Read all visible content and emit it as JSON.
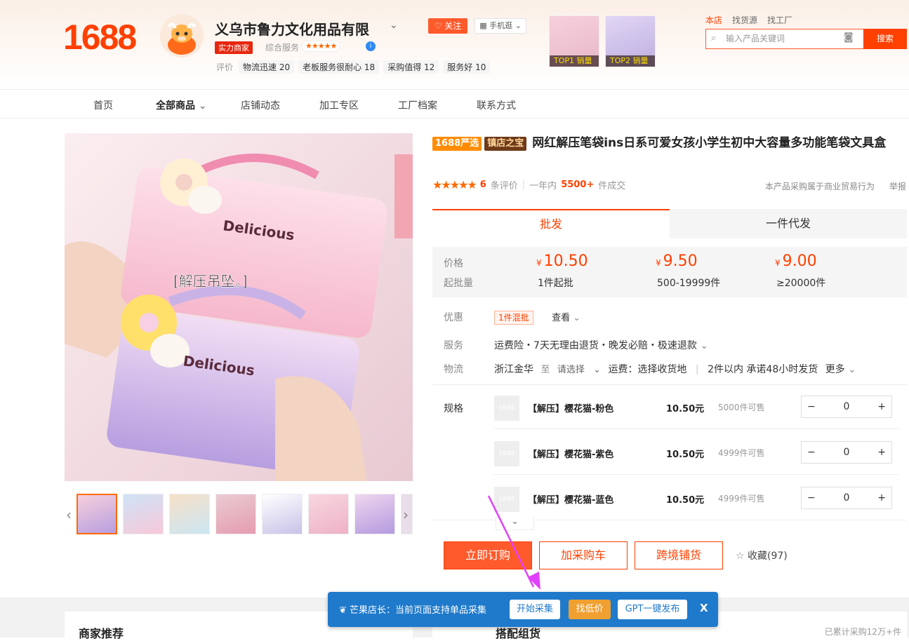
{
  "header": {
    "logo": "1688",
    "shop_name": "义乌市鲁力文化用品有限",
    "strength_badge": "实力商家",
    "service_label": "综合服务",
    "service_stars": "★★★★★",
    "tags_label": "评价",
    "tags": [
      "物流迅速 20",
      "老板服务很耐心 18",
      "采购值得 12",
      "服务好 10"
    ],
    "follow_label": "关注",
    "mobile_label": "手机逛",
    "top1_label": "TOP1 销量",
    "top2_label": "TOP2 销量",
    "top_links": [
      "本店",
      "找货源",
      "找工厂"
    ],
    "search_placeholder": "输入产品关键词",
    "search_button": "搜索"
  },
  "nav": {
    "items": [
      "首页",
      "全部商品",
      "店铺动态",
      "加工专区",
      "工厂档案",
      "联系方式"
    ]
  },
  "gallery": {
    "overlay_text": "[解压吊坠。]",
    "brand_text": "Delicious"
  },
  "product": {
    "badge_yx": "1688严选",
    "badge_zd": "镇店之宝",
    "title": "网红解压笔袋ins日系可爱女孩小学生初中大容量多功能笔袋文具盒",
    "stars": "★★★★★",
    "review_count": "6",
    "review_label": "条评价",
    "year_label": "一年内",
    "sold": "5500+",
    "sold_label": "件成交",
    "note": "本产品采购属于商业贸易行为",
    "report": "举报"
  },
  "tabs": [
    "批发",
    "一件代发"
  ],
  "pricing": {
    "price_label": "价格",
    "moq_label": "起批量",
    "currency": "¥",
    "tiers": [
      {
        "price": "10.50",
        "qty": "1件起批"
      },
      {
        "price": "9.50",
        "qty": "500-19999件"
      },
      {
        "price": "9.00",
        "qty": "≥20000件"
      }
    ]
  },
  "promo": {
    "label": "优惠",
    "tag": "1件混批",
    "view": "查看"
  },
  "service": {
    "label": "服务",
    "text": "运费险・7天无理由退货・晚发必赔・极速退款"
  },
  "logistics": {
    "label": "物流",
    "origin": "浙江金华",
    "to": "至",
    "select": "请选择",
    "fee": "运费：选择收货地",
    "ship": "2件以内 承诺48小时发货",
    "more": "更多"
  },
  "specs": {
    "label": "规格",
    "items": [
      {
        "name": "【解压】樱花猫-粉色",
        "price": "10.50元",
        "stock": "5000件可售",
        "qty": "0"
      },
      {
        "name": "【解压】樱花猫-紫色",
        "price": "10.50元",
        "stock": "4999件可售",
        "qty": "0"
      },
      {
        "name": "【解压】樱花猫-蓝色",
        "price": "10.50元",
        "stock": "4999件可售",
        "qty": "0"
      }
    ]
  },
  "actions": {
    "buy": "立即订购",
    "cart": "加采购车",
    "cross": "跨境铺货",
    "fav": "收藏(97)"
  },
  "bottom": {
    "rec": "商家推荐",
    "match": "搭配组货",
    "count": "已累计采购12万+件"
  },
  "plugin": {
    "text": "芒果店长：当前页面支持单品采集",
    "start": "开始采集",
    "low": "找低价",
    "gpt": "GPT一键发布",
    "close": "X"
  },
  "colors": {
    "brand": "#ff4000",
    "plugin_blue": "#1f7acb",
    "arrow": "#e040fb"
  }
}
